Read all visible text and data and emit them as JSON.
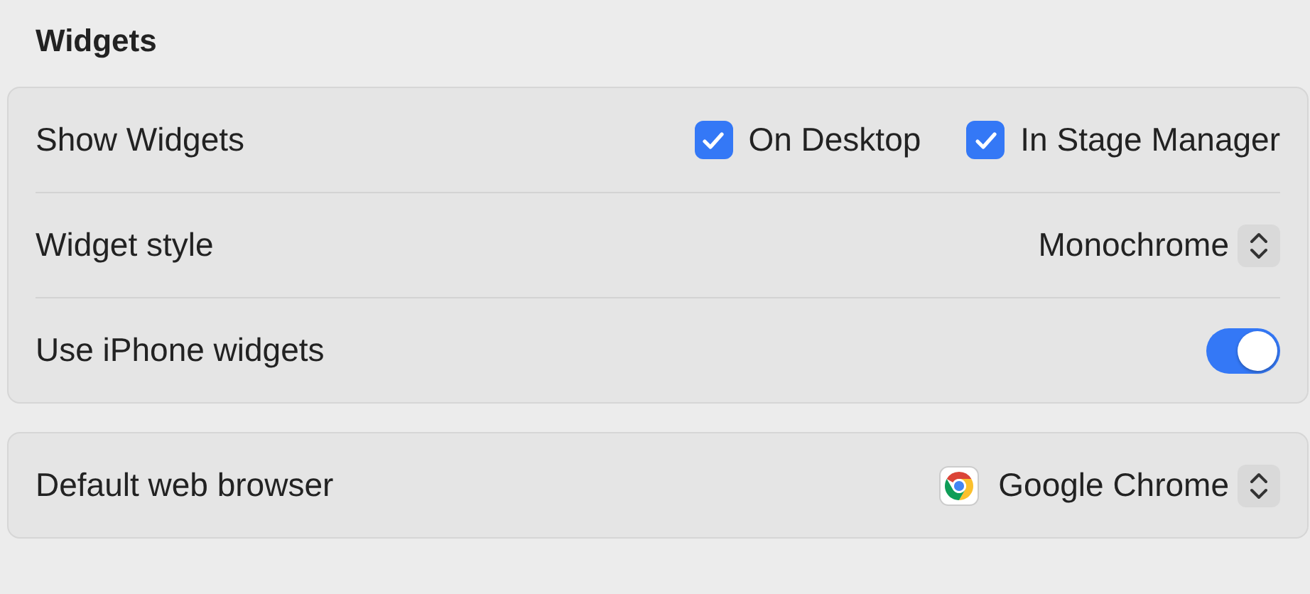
{
  "title": "Widgets",
  "groups": [
    {
      "rows": [
        {
          "kind": "checkboxes",
          "label": "Show Widgets",
          "options": [
            {
              "label": "On Desktop",
              "checked": true
            },
            {
              "label": "In Stage Manager",
              "checked": true
            }
          ]
        },
        {
          "kind": "popup",
          "label": "Widget style",
          "value": "Monochrome"
        },
        {
          "kind": "toggle",
          "label": "Use iPhone widgets",
          "on": true
        }
      ]
    },
    {
      "rows": [
        {
          "kind": "app_popup",
          "label": "Default web browser",
          "value": "Google Chrome"
        }
      ]
    }
  ]
}
